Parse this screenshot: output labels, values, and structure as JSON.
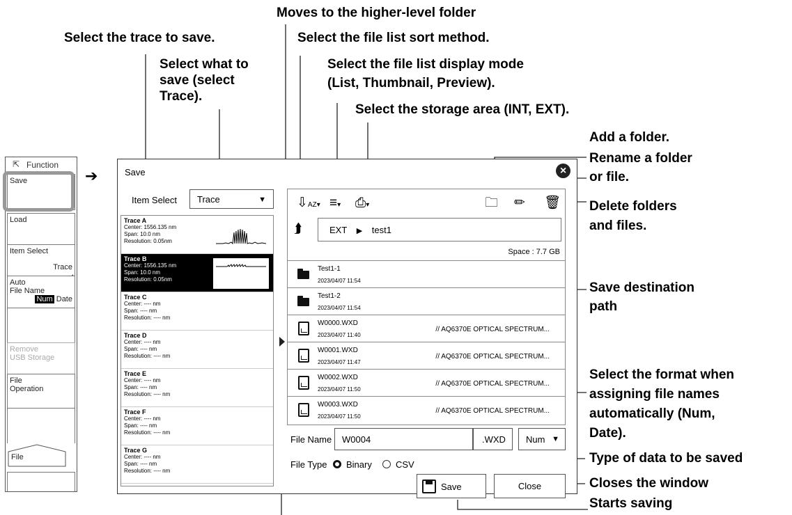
{
  "callouts": {
    "higher_folder": "Moves to the higher-level folder",
    "select_trace": "Select the trace to save.",
    "sort_method": "Select the file list sort method.",
    "what_to_save": [
      "Select what to",
      "save (select",
      "Trace)."
    ],
    "display_mode": [
      "Select the file list display mode",
      "(List, Thumbnail, Preview)."
    ],
    "storage_area": "Select the storage area (INT, EXT).",
    "add_folder": "Add a folder.",
    "rename": [
      "Rename a folder",
      "or file."
    ],
    "delete": [
      "Delete folders",
      "and files."
    ],
    "save_dest": [
      "Save destination",
      "path"
    ],
    "format": [
      "Select the format when",
      "assigning file names",
      "automatically (Num,",
      "Date)."
    ],
    "type_of_data": "Type of data to be saved",
    "closes_window": "Closes the window",
    "starts_saving": "Starts saving"
  },
  "softkeys": {
    "top_label": "Function",
    "save": "Save",
    "load": "Load",
    "item_select": "Item Select",
    "item_select_value": "Trace",
    "auto_file_name": [
      "Auto",
      "File Name"
    ],
    "num": "Num",
    "date": "Date",
    "remove_usb": [
      "Remove",
      "USB Storage"
    ],
    "file_operation": [
      "File",
      "Operation"
    ],
    "file_tab": "File"
  },
  "dialog": {
    "title": "Save",
    "item_select_label": "Item Select",
    "item_select_value": "Trace",
    "traces": [
      {
        "name": "Trace A",
        "center": "Center: 1556.135 nm",
        "span": "Span: 10.0 nm",
        "resolution": "Resolution: 0.05nm"
      },
      {
        "name": "Trace B",
        "center": "Center: 1556.135 nm",
        "span": "Span: 10.0 nm",
        "resolution": "Resolution: 0.05nm"
      },
      {
        "name": "Trace C",
        "center": "Center: ---- nm",
        "span": "Span: ---- nm",
        "resolution": "Resolution: ---- nm"
      },
      {
        "name": "Trace D",
        "center": "Center: ---- nm",
        "span": "Span: ---- nm",
        "resolution": "Resolution: ---- nm"
      },
      {
        "name": "Trace E",
        "center": "Center: ---- nm",
        "span": "Span: ---- nm",
        "resolution": "Resolution: ---- nm"
      },
      {
        "name": "Trace F",
        "center": "Center: ---- nm",
        "span": "Span: ---- nm",
        "resolution": "Resolution: ---- nm"
      },
      {
        "name": "Trace G",
        "center": "Center: ---- nm",
        "span": "Span: ---- nm",
        "resolution": "Resolution: ---- nm"
      }
    ],
    "path": {
      "drive": "EXT",
      "folder": "test1"
    },
    "space": "Space :    7.7 GB",
    "files": [
      {
        "name": "Test1-1",
        "date": "2023/04/07 11:54",
        "desc": "",
        "icon": "folder"
      },
      {
        "name": "Test1-2",
        "date": "2023/04/07 11:54",
        "desc": "",
        "icon": "folder"
      },
      {
        "name": "W0000.WXD",
        "date": "2023/04/07 11:40",
        "desc": "// AQ6370E OPTICAL SPECTRUM...",
        "icon": "waveform-file"
      },
      {
        "name": "W0001.WXD",
        "date": "2023/04/07 11:47",
        "desc": "// AQ6370E OPTICAL SPECTRUM...",
        "icon": "waveform-file"
      },
      {
        "name": "W0002.WXD",
        "date": "2023/04/07 11:50",
        "desc": "// AQ6370E OPTICAL SPECTRUM...",
        "icon": "waveform-file"
      },
      {
        "name": "W0003.WXD",
        "date": "2023/04/07 11:50",
        "desc": "// AQ6370E OPTICAL SPECTRUM...",
        "icon": "waveform-file"
      }
    ],
    "file_name_label": "File Name",
    "file_name_value": "W0004",
    "extension": ".WXD",
    "name_format": "Num",
    "file_type_label": "File Type",
    "file_type_options": [
      "Binary",
      "CSV"
    ],
    "file_type_selected": "Binary",
    "save_button": "Save",
    "close_button": "Close"
  }
}
